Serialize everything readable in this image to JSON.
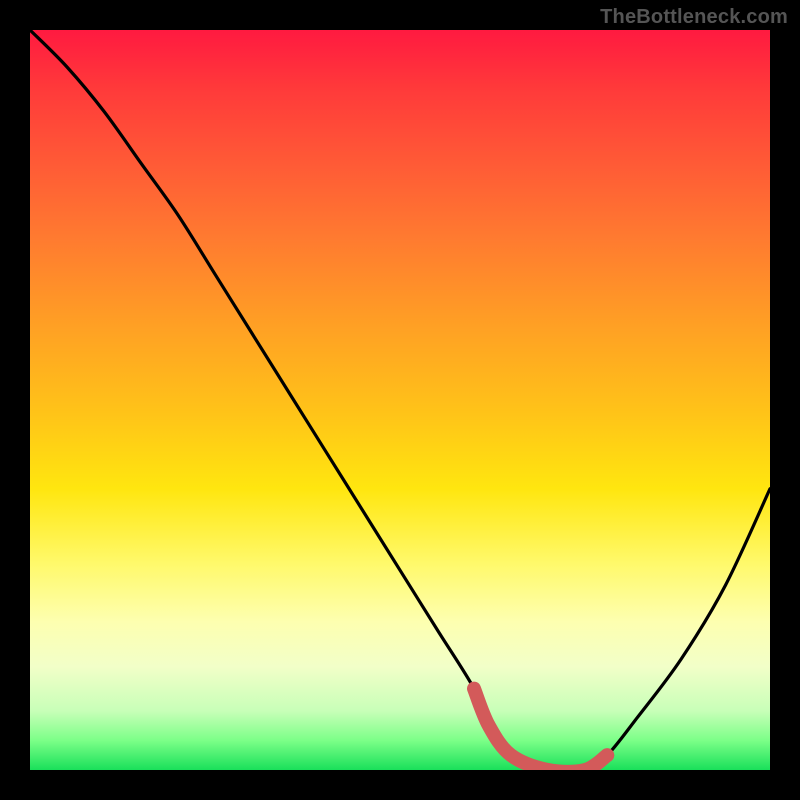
{
  "watermark": "TheBottleneck.com",
  "colors": {
    "background": "#000000",
    "curve": "#000000",
    "marker": "#d35a5a",
    "gradient_top": "#ff1a40",
    "gradient_bottom": "#19e05a"
  },
  "chart_data": {
    "type": "line",
    "title": "",
    "xlabel": "",
    "ylabel": "",
    "xlim": [
      0,
      100
    ],
    "ylim": [
      0,
      100
    ],
    "grid": false,
    "series": [
      {
        "name": "bottleneck-curve",
        "x": [
          0,
          5,
          10,
          15,
          20,
          25,
          30,
          35,
          40,
          45,
          50,
          55,
          60,
          62,
          65,
          70,
          75,
          78,
          82,
          88,
          94,
          100
        ],
        "values": [
          100,
          95,
          89,
          82,
          75,
          67,
          59,
          51,
          43,
          35,
          27,
          19,
          11,
          6,
          2,
          0,
          0,
          2,
          7,
          15,
          25,
          38
        ]
      }
    ],
    "annotations": [
      {
        "name": "marker-segment",
        "x_start": 60,
        "x_end": 78,
        "style": "thick-rounded",
        "color": "#d35a5a"
      },
      {
        "name": "marker-dot",
        "x": 78,
        "y": 2,
        "color": "#d35a5a"
      }
    ]
  }
}
